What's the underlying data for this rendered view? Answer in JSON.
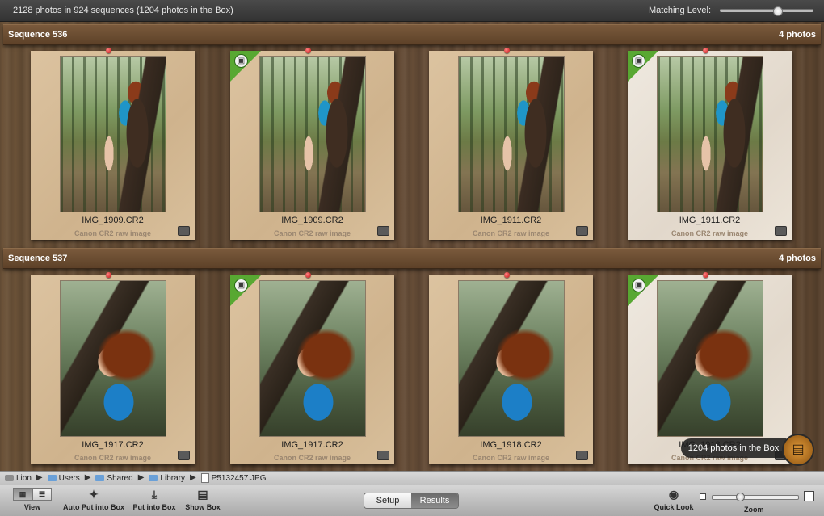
{
  "topbar": {
    "info": "2128 photos in 924 sequences (1204 photos in the Box)",
    "matching_label": "Matching Level:",
    "matching_level": 0.62
  },
  "sequences": [
    {
      "title": "Sequence 536",
      "count": "4 photos",
      "photos": [
        {
          "name": "IMG_1909.CR2",
          "type": "Canon CR2 raw image",
          "in_box": false
        },
        {
          "name": "IMG_1909.CR2",
          "type": "Canon CR2 raw image",
          "in_box": true
        },
        {
          "name": "IMG_1911.CR2",
          "type": "Canon CR2 raw image",
          "in_box": false
        },
        {
          "name": "IMG_1911.CR2",
          "type": "Canon CR2 raw image",
          "in_box": true
        }
      ]
    },
    {
      "title": "Sequence 537",
      "count": "4 photos",
      "photos": [
        {
          "name": "IMG_1917.CR2",
          "type": "Canon CR2 raw image",
          "in_box": false
        },
        {
          "name": "IMG_1917.CR2",
          "type": "Canon CR2 raw image",
          "in_box": true
        },
        {
          "name": "IMG_1918.CR2",
          "type": "Canon CR2 raw image",
          "in_box": false
        },
        {
          "name": "IMG_1918.CR2",
          "type": "Canon CR2 raw image",
          "in_box": true
        }
      ]
    }
  ],
  "tooltip": {
    "text": "1204 photos in the Box",
    "icon": "box-icon"
  },
  "path": [
    "Lion",
    "Users",
    "Shared",
    "Library",
    "P5132457.JPG"
  ],
  "toolbar": {
    "view_label": "View",
    "auto_put_label": "Auto Put into Box",
    "put_into_box_label": "Put into Box",
    "show_box_label": "Show Box",
    "segments": [
      "Setup",
      "Results"
    ],
    "selected_segment": "Results",
    "quick_look_label": "Quick Look",
    "zoom_label": "Zoom",
    "zoom_level": 0.3
  },
  "colors": {
    "ribbon": "#58a832",
    "pin": "#c01010",
    "header_wood": "#6b4c30"
  }
}
